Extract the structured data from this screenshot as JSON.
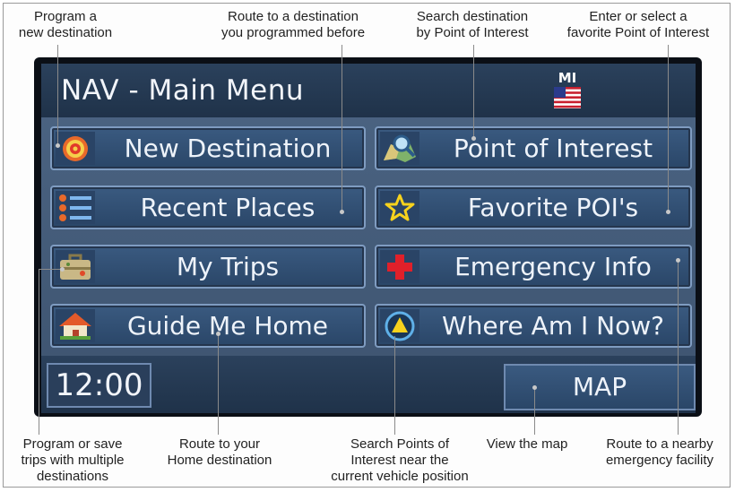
{
  "screen": {
    "title": "NAV - Main Menu",
    "state_code": "MI",
    "clock": "12:00",
    "map_label": "MAP"
  },
  "menu": {
    "new_destination": "New Destination",
    "point_of_interest": "Point of Interest",
    "recent_places": "Recent Places",
    "favorite_pois": "Favorite POI's",
    "my_trips": "My Trips",
    "emergency_info": "Emergency Info",
    "guide_me_home": "Guide Me Home",
    "where_am_i_now": "Where Am I Now?"
  },
  "callouts": {
    "new_destination": "Program a\nnew destination",
    "recent_places": "Route to a destination\nyou programmed before",
    "point_of_interest": "Search destination\nby Point of Interest",
    "favorite_pois": "Enter or select a\nfavorite Point of Interest",
    "my_trips": "Program or save\ntrips with multiple\ndestinations",
    "guide_me_home": "Route to your\nHome destination",
    "where_am_i_now": "Search Points of\nInterest near the\ncurrent vehicle position",
    "map": "View the map",
    "emergency_info": "Route to a nearby\nemergency facility"
  },
  "icons": {
    "new_destination": "target-icon",
    "point_of_interest": "map-search-icon",
    "recent_places": "list-icon",
    "favorite_pois": "star-icon",
    "my_trips": "suitcase-icon",
    "emergency_info": "red-cross-icon",
    "guide_me_home": "house-icon",
    "where_am_i_now": "location-arrow-icon",
    "state_flag": "us-flag-icon"
  },
  "colors": {
    "panel": "#3d536f",
    "header": "#1f3249",
    "button": "#2a4668",
    "button_border": "#7f9cc1",
    "text": "#eef3fa",
    "emergency_red": "#e0202a",
    "star_yellow": "#f7d21d"
  }
}
